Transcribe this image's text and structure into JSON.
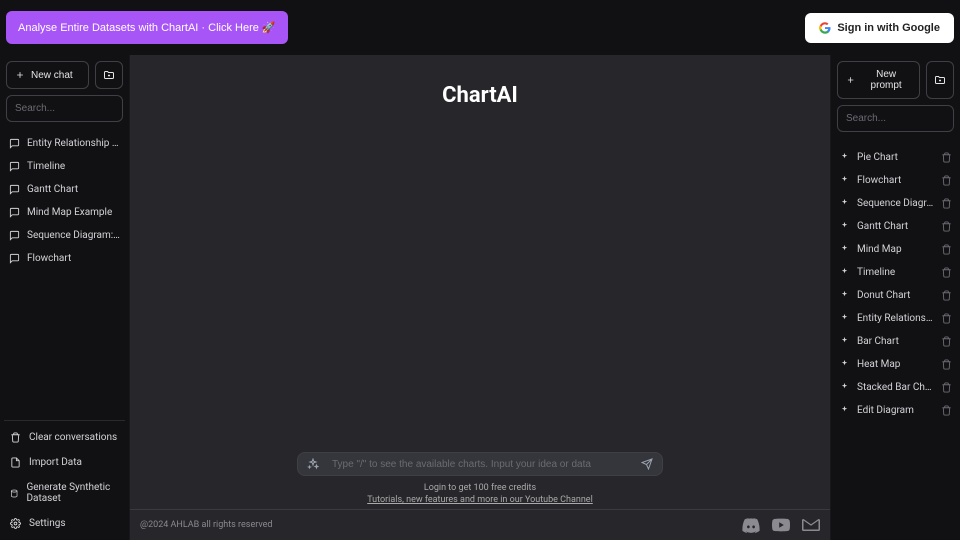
{
  "topbar": {
    "promo": "Analyse Entire Datasets with ChartAI · Click Here 🚀",
    "signin": "Sign in with Google"
  },
  "left": {
    "new_chat": "New chat",
    "search_placeholder": "Search...",
    "conversations": [
      "Entity Relationship Diagram",
      "Timeline",
      "Gantt Chart",
      "Mind Map Example",
      "Sequence Diagram: Blogging...",
      "Flowchart"
    ],
    "actions": {
      "clear": "Clear conversations",
      "import": "Import Data",
      "generate": "Generate Synthetic Dataset",
      "settings": "Settings"
    }
  },
  "main": {
    "title": "ChartAI",
    "input_placeholder": "Type \"/\" to see the available charts. Input your idea or data",
    "login_hint": "Login to get 100 free credits",
    "yt_link": "Tutorials, new features and more in our Youtube Channel",
    "footer": "@2024 AHLAB all rights reserved"
  },
  "right": {
    "new_prompt": "New prompt",
    "search_placeholder": "Search...",
    "prompts": [
      "Pie Chart",
      "Flowchart",
      "Sequence Diagram",
      "Gantt Chart",
      "Mind Map",
      "Timeline",
      "Donut Chart",
      "Entity Relationship Diagram",
      "Bar Chart",
      "Heat Map",
      "Stacked Bar Chart",
      "Edit Diagram"
    ]
  }
}
